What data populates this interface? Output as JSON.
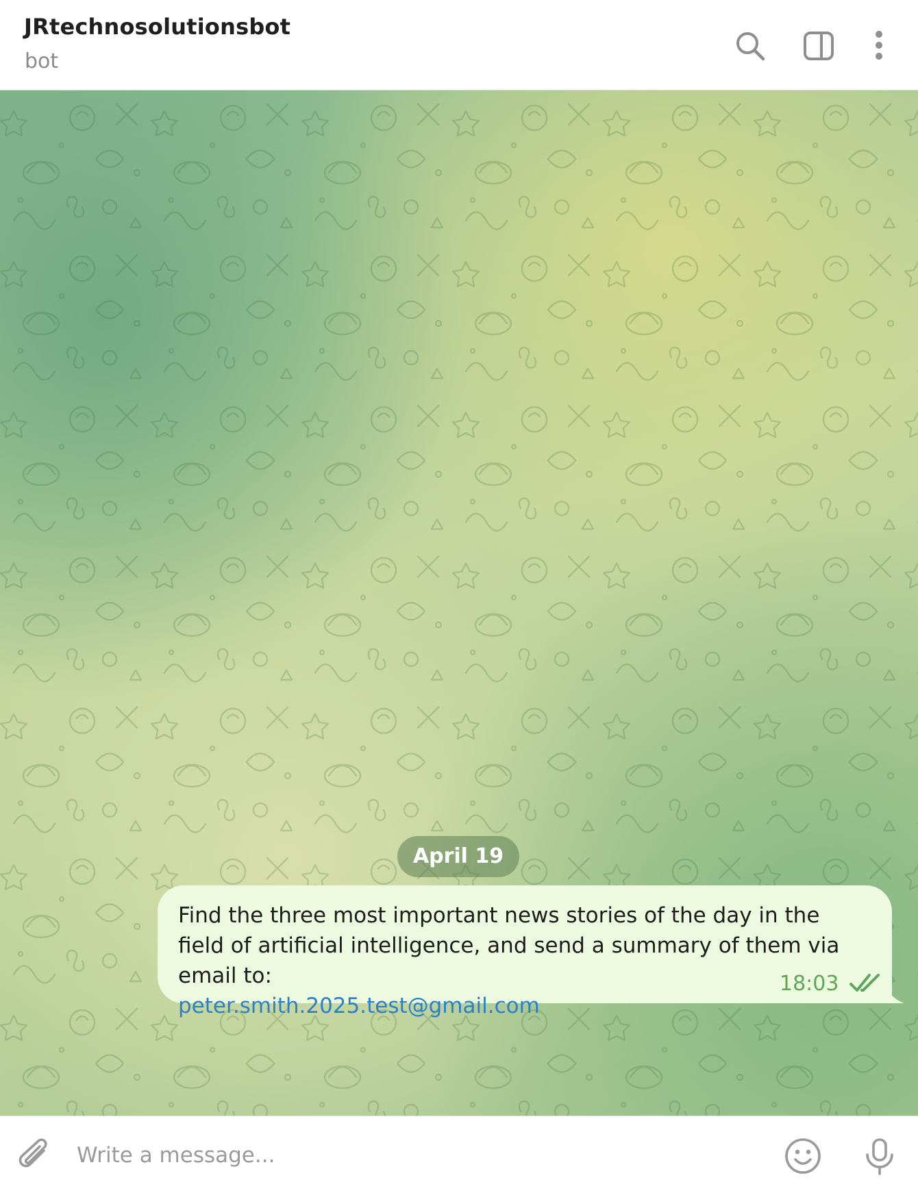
{
  "header": {
    "title": "JRtechnosolutionsbot",
    "subtitle": "bot",
    "icons": [
      "search-icon",
      "sidebar-toggle-icon",
      "more-vertical-icon"
    ]
  },
  "chat": {
    "date_separator": "April 19",
    "messages": [
      {
        "text": "Find the three most important news stories of the day in the field of artificial intelligence, and send a summary of them via email to:",
        "link": "peter.smith.2025.test@gmail.com",
        "time": "18:03",
        "status_icon": "double-check-icon",
        "outgoing": true
      }
    ]
  },
  "composer": {
    "placeholder": "Write a message...",
    "icons": [
      "paperclip-icon",
      "emoji-icon",
      "microphone-icon"
    ]
  },
  "colors": {
    "accent_link": "#2a80c9",
    "outgoing_bubble": "#eefadf",
    "time_and_check": "#5fa65a",
    "date_pill": "#5c8056"
  }
}
